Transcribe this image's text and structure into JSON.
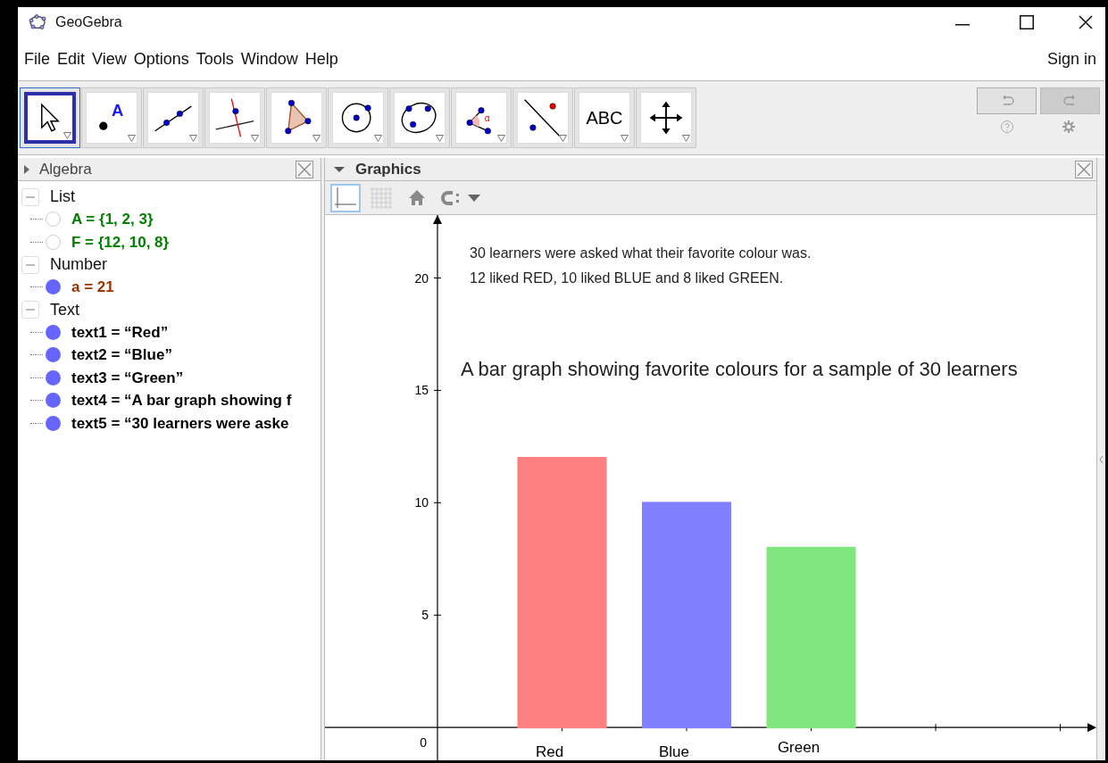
{
  "window": {
    "title": "GeoGebra"
  },
  "menu": [
    "File",
    "Edit",
    "View",
    "Options",
    "Tools",
    "Window",
    "Help"
  ],
  "sign_in": "Sign in",
  "tools": [
    {
      "kind": "move",
      "selected": true
    },
    {
      "kind": "point",
      "selected": false,
      "label": "A"
    },
    {
      "kind": "line",
      "selected": false
    },
    {
      "kind": "perpendicular",
      "selected": false
    },
    {
      "kind": "polygon",
      "selected": false
    },
    {
      "kind": "circle",
      "selected": false
    },
    {
      "kind": "conic",
      "selected": false
    },
    {
      "kind": "angle",
      "selected": false,
      "label": "α"
    },
    {
      "kind": "reflect",
      "selected": false
    },
    {
      "kind": "text",
      "selected": false,
      "label": "ABC"
    },
    {
      "kind": "pan",
      "selected": false
    }
  ],
  "redo": {
    "disabled": true
  },
  "algebra": {
    "title": "Algebra",
    "groups": [
      {
        "label": "List",
        "expanded": true,
        "children": [
          {
            "text": "A = {1, 2, 3}",
            "visible": false,
            "color": "#007f00"
          },
          {
            "text": "F = {12, 10, 8}",
            "visible": false,
            "color": "#007f00"
          }
        ]
      },
      {
        "label": "Number",
        "expanded": true,
        "children": [
          {
            "text": "a = 21",
            "visible": true,
            "color": "#993300"
          }
        ]
      },
      {
        "label": "Text",
        "expanded": true,
        "children": [
          {
            "text": "text1 = “Red”",
            "visible": true,
            "color": "#000000"
          },
          {
            "text": "text2 = “Blue”",
            "visible": true,
            "color": "#000000"
          },
          {
            "text": "text3 = “Green”",
            "visible": true,
            "color": "#000000"
          },
          {
            "text": "text4 = “A bar graph showing f",
            "visible": true,
            "color": "#000000"
          },
          {
            "text": "text5 = “30 learners were aske",
            "visible": true,
            "color": "#000000"
          }
        ]
      }
    ]
  },
  "graphics": {
    "title": "Graphics",
    "view_buttons": [
      {
        "kind": "axes",
        "selected": true
      },
      {
        "kind": "grid",
        "selected": false
      },
      {
        "kind": "home",
        "selected": false
      },
      {
        "kind": "capture",
        "selected": false
      }
    ],
    "notes": [
      "30 learners were asked what their favorite colour was.",
      "12 liked RED, 10 liked BLUE and 8 liked GREEN."
    ],
    "origin_label": "0",
    "chart_data": {
      "type": "bar",
      "title": "A bar graph showing favorite colours for a sample of 30 learners",
      "categories": [
        "Red",
        "Blue",
        "Green"
      ],
      "values": [
        12,
        10,
        8
      ],
      "colors": [
        "#ff8080",
        "#8080ff",
        "#80e680"
      ],
      "ylim": [
        -1.5,
        22.8
      ],
      "yticks": [
        5,
        10,
        15,
        20
      ]
    }
  }
}
